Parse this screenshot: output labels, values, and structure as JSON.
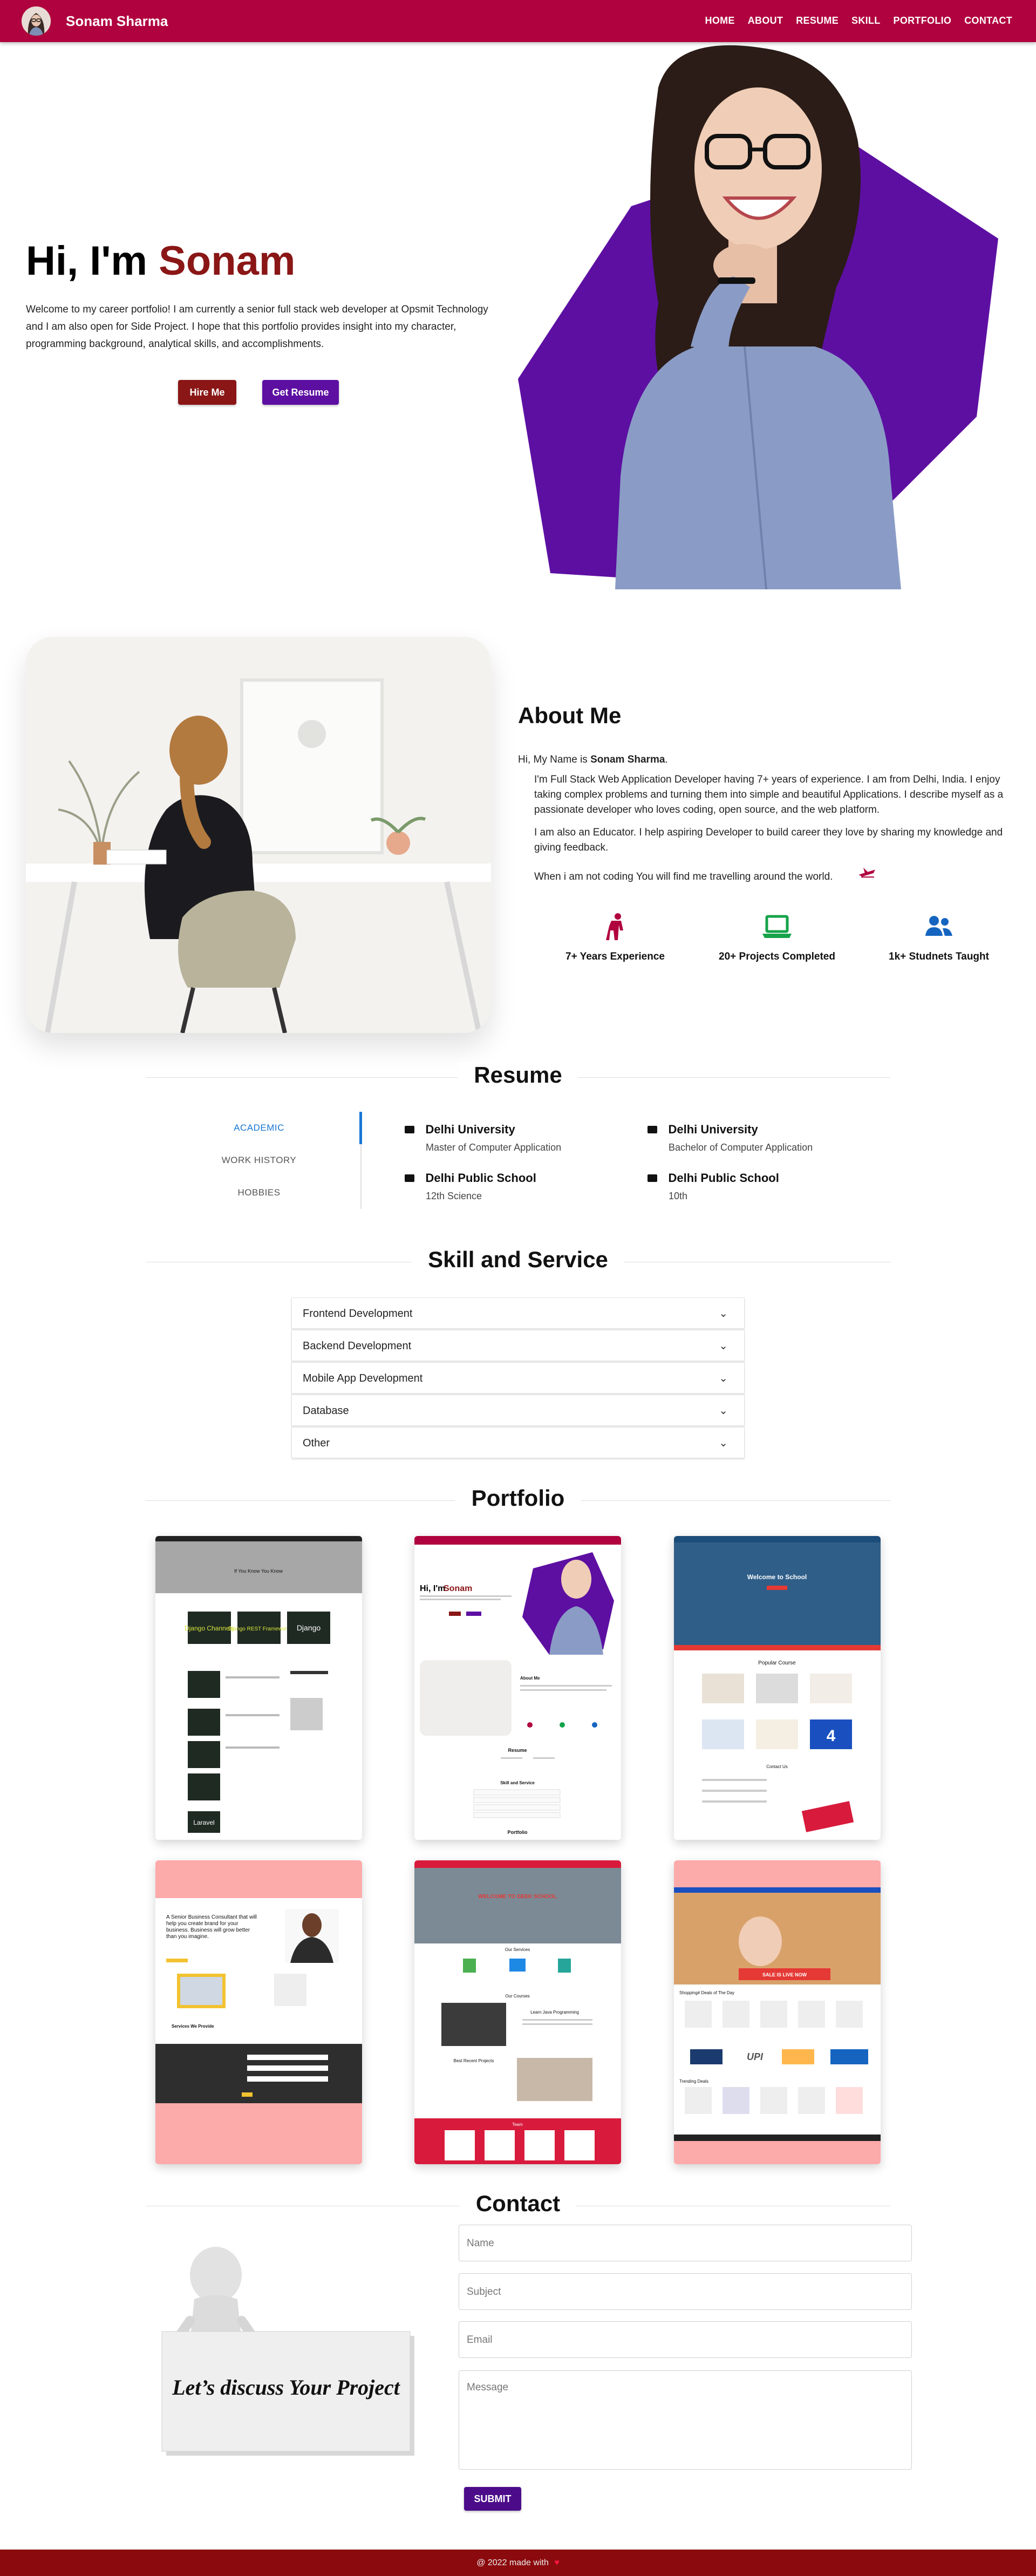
{
  "nav": {
    "brand": "Sonam Sharma",
    "links": [
      "HOME",
      "ABOUT",
      "RESUME",
      "SKILL",
      "PORTFOLIO",
      "CONTACT"
    ]
  },
  "hero": {
    "greeting": "Hi, I'm",
    "name": "Sonam",
    "text": "Welcome to my career portfolio! I am currently a senior full stack web developer at Opsmit Technology and I am also open for Side Project. I hope that this portfolio provides insight into my character, programming background, analytical skills, and accomplishments.",
    "hire_label": "Hire Me",
    "resume_label": "Get Resume",
    "accent": "#8a1616",
    "hexagon_color": "#5d0fa2"
  },
  "about": {
    "title": "About Me",
    "intro_prefix": "Hi, My Name is",
    "intro_name": "Sonam Sharma",
    "intro_suffix": ".",
    "p1": "I'm Full Stack Web Application Developer having 7+ years of experience. I am from Delhi, India. I enjoy taking complex problems and turning them into simple and beautiful Applications. I describe myself as a passionate developer who loves coding, open source, and the web platform.",
    "p2": "I am also an Educator. I help aspiring Developer to build career they love by sharing my knowledge and giving feedback.",
    "p3": "When i am not coding You will find me travelling around the world.",
    "stats": [
      {
        "label": "7+ Years Experience",
        "icon": "person-icon",
        "color": "#b0023e"
      },
      {
        "label": "20+ Projects Completed",
        "icon": "laptop-icon",
        "color": "#16a34a"
      },
      {
        "label": "1k+ Studnets Taught",
        "icon": "group-icon",
        "color": "#1565c0"
      }
    ]
  },
  "resume": {
    "title": "Resume",
    "tabs": [
      "ACADEMIC",
      "WORK HISTORY",
      "HOBBIES"
    ],
    "items": [
      {
        "title": "Delhi University",
        "sub": "Master of Computer Application"
      },
      {
        "title": "Delhi University",
        "sub": "Bachelor of Computer Application"
      },
      {
        "title": "Delhi Public School",
        "sub": "12th Science"
      },
      {
        "title": "Delhi Public School",
        "sub": "10th"
      }
    ]
  },
  "skills": {
    "title": "Skill and Service",
    "items": [
      "Frontend Development",
      "Backend Development",
      "Mobile App Development",
      "Database",
      "Other"
    ]
  },
  "portfolio": {
    "title": "Portfolio",
    "thumb1": {
      "heading": "If You Know You Know",
      "tiles": [
        "Django Channels",
        "Django REST Framework",
        "Django",
        "Laravel"
      ]
    },
    "thumb2": {
      "greeting": "Hi, I'm",
      "name": "Sonam",
      "about": "About Me",
      "resume": "Resume",
      "skills": "Skill and Service",
      "portfolio": "Portfolio"
    },
    "thumb3": {
      "welcome": "Welcome to School",
      "popular": "Popular Course",
      "number": "4",
      "contact": "Contact Us"
    },
    "thumb4": {
      "headline": "A Senior Business Consultant that will help you create brand for your business. Business will grow better than you imagine.",
      "services": "Services We Provide"
    },
    "thumb5": {
      "welcome": "WELCOME TO GEEK SCHOOL",
      "services": "Our Services",
      "courses": "Our Courses",
      "learn": "Learn Java Programming",
      "recent": "Best Recent Projects",
      "team": "Team"
    },
    "thumb6": {
      "promo": "SALE IS LIVE NOW",
      "shop": "Shopping# Deals of The Day",
      "trending": "Trending Deals",
      "upi": "UPI"
    }
  },
  "contact": {
    "title": "Contact",
    "card_text": "Let’s discuss Your Project",
    "name_placeholder": "Name",
    "subject_placeholder": "Subject",
    "email_placeholder": "Email",
    "message_placeholder": "Message",
    "submit_label": "SUBMIT"
  },
  "footer": {
    "text": "@ 2022 made with"
  }
}
